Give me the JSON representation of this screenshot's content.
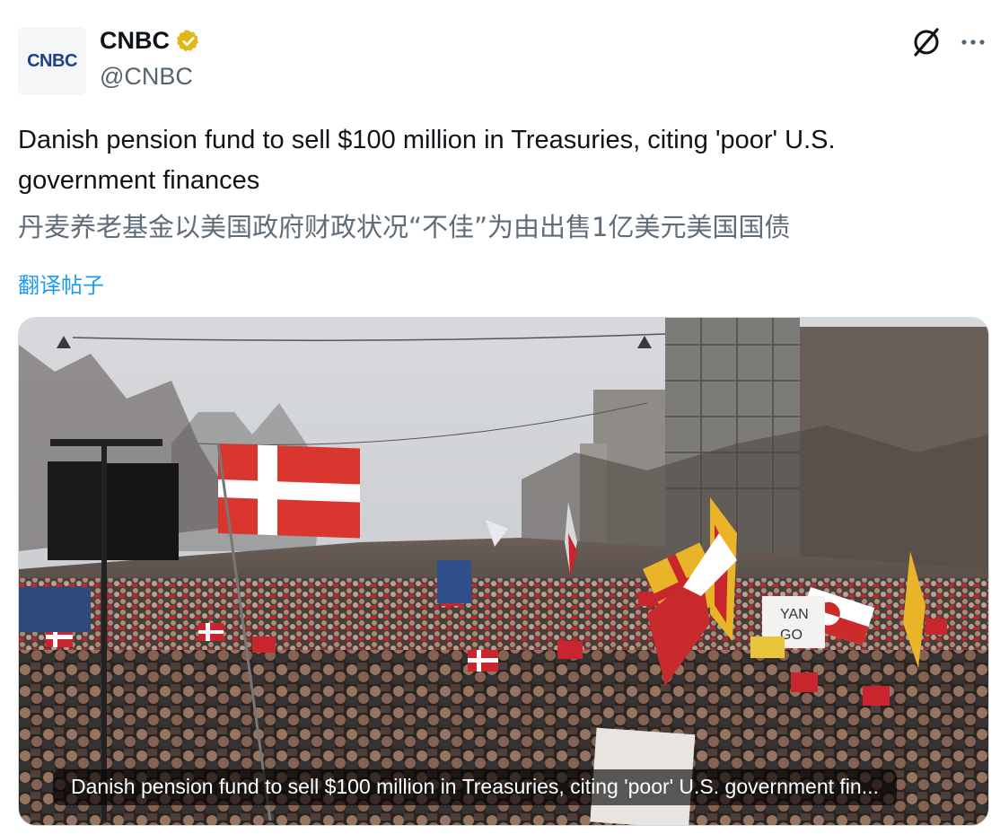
{
  "author": {
    "display_name": "CNBC",
    "handle": "@CNBC",
    "avatar_text": "CNBC",
    "verified": true,
    "verified_color": "#e2b719"
  },
  "tweet": {
    "text": "Danish pension fund to sell $100 million in Treasuries, citing 'poor' U.S. government finances",
    "translated_text": "丹麦养老基金以美国政府财政状况“不佳”为由出售1亿美元美国国债",
    "translate_link": "翻译帖子"
  },
  "media": {
    "caption": "Danish pension fund to sell $100 million in Treasuries, citing 'poor' U.S. government fin...",
    "photo_subject": "crowd-protest-with-flags",
    "sign_text": "YAN GO"
  },
  "icons": {
    "grok": "grok-icon",
    "more": "more-options-icon",
    "verified": "verified-badge-icon"
  },
  "colors": {
    "link": "#1d9bf0",
    "secondary_text": "#536471"
  }
}
